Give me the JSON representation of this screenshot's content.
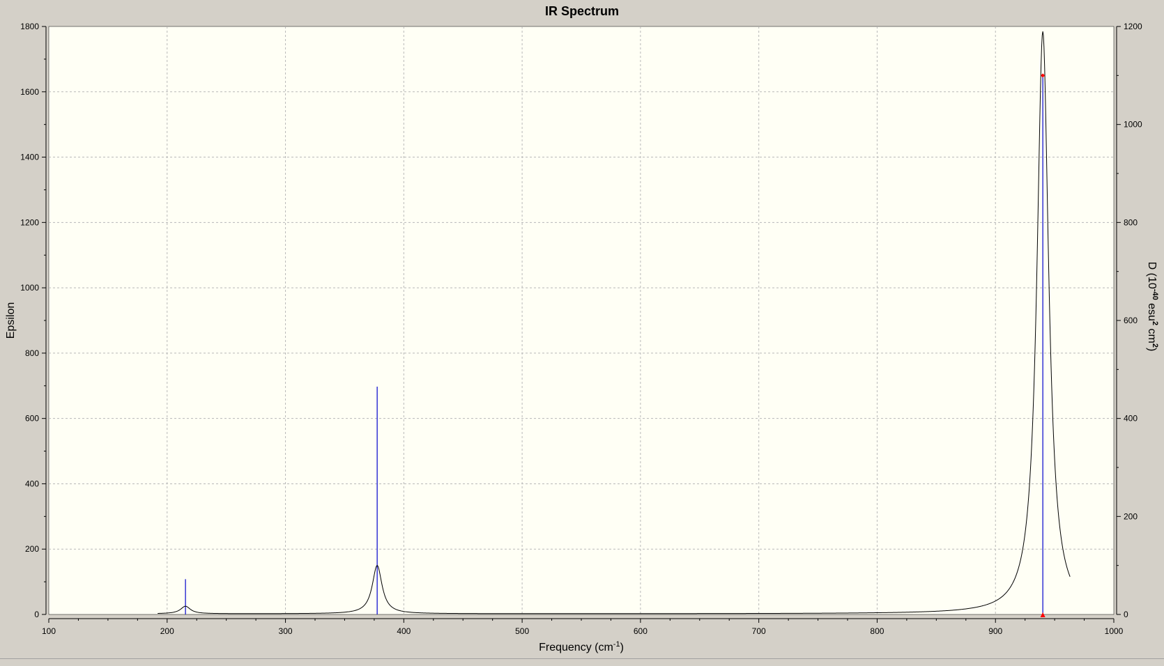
{
  "window": {
    "title": "IR Spectrum"
  },
  "chart_data": {
    "type": "line",
    "title": "IR Spectrum",
    "xlabel": "Frequency (cm-1)",
    "ylabel_left": "Epsilon",
    "ylabel_right": "D (10-40 esu2 cm2)",
    "xlim": [
      100,
      1000
    ],
    "ylim_left": [
      0,
      1800
    ],
    "ylim_right": [
      0,
      1200
    ],
    "x_ticks": [
      100,
      200,
      300,
      400,
      500,
      600,
      700,
      800,
      900,
      1000
    ],
    "y_ticks_left": [
      0,
      200,
      400,
      600,
      800,
      1000,
      1200,
      1400,
      1600,
      1800
    ],
    "y_ticks_right": [
      0,
      200,
      400,
      600,
      800,
      1000,
      1200
    ],
    "grid": true,
    "colors": {
      "plot_background": "#fffff5",
      "frame": "#d4d0c8",
      "spectrum": "#000000",
      "stick": "#0000cc",
      "marker": "#ff0000"
    },
    "spectrum_range": [
      192,
      963
    ],
    "background_level": 2,
    "peaks": [
      {
        "freq": 215.5,
        "intensity_D": 72,
        "epsilon_peak": 25
      },
      {
        "freq": 377.5,
        "intensity_D": 465,
        "epsilon_peak": 150
      },
      {
        "freq": 940,
        "intensity_D": 1100,
        "epsilon_peak": 1785
      }
    ],
    "selected_peak_freq": 940
  }
}
